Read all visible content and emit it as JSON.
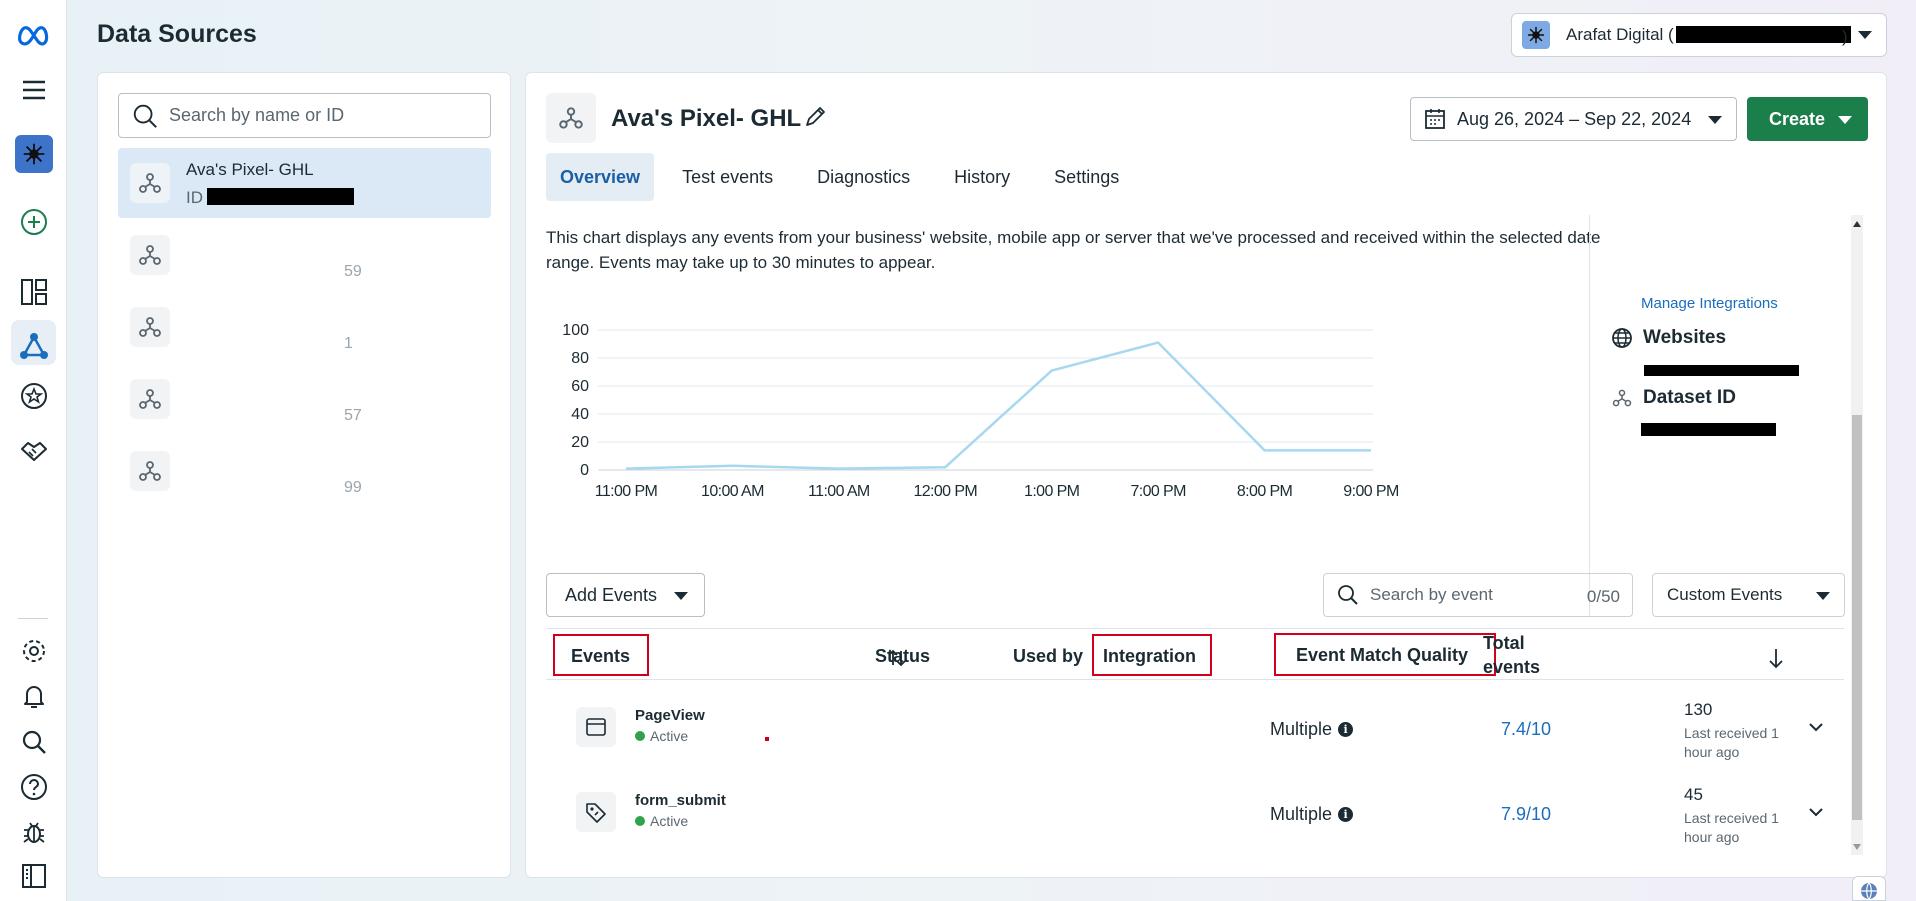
{
  "header": {
    "title": "Data Sources"
  },
  "account": {
    "name": "Arafat Digital (",
    "suffix": ")"
  },
  "sidebar": {
    "search_placeholder": "Search by name or ID",
    "items": [
      {
        "name": "Ava's Pixel- GHL",
        "id_label": "ID"
      },
      {
        "name": "",
        "id_fragment": "59"
      },
      {
        "name": "",
        "id_fragment": "1"
      },
      {
        "name": "",
        "id_fragment": "57"
      },
      {
        "name": "",
        "id_fragment": "99"
      }
    ]
  },
  "pixel": {
    "title": "Ava's Pixel- GHL"
  },
  "toolbar": {
    "date_range": "Aug 26, 2024 – Sep 22, 2024",
    "create_label": "Create"
  },
  "tabs": [
    "Overview",
    "Test events",
    "Diagnostics",
    "History",
    "Settings"
  ],
  "overview": {
    "description": "This chart displays any events from your business' website, mobile app or server that we've processed and received within the selected date range. Events may take up to 30 minutes to appear."
  },
  "chart_data": {
    "type": "line",
    "categories": [
      "11:00 PM",
      "10:00 AM",
      "11:00 AM",
      "12:00 PM",
      "1:00 PM",
      "7:00 PM",
      "8:00 PM",
      "9:00 PM"
    ],
    "series": [
      {
        "values": [
          1,
          3,
          1,
          2,
          71,
          91,
          14,
          14
        ],
        "color": "#a8d8f0"
      }
    ],
    "y_ticks": [
      0,
      20,
      40,
      60,
      80,
      100
    ],
    "ylim": [
      0,
      100
    ],
    "grid": true,
    "title": "",
    "xlabel": "",
    "ylabel": ""
  },
  "side_info": {
    "manage_integrations": "Manage Integrations",
    "websites_label": "Websites",
    "dataset_id_label": "Dataset ID"
  },
  "events_toolbar": {
    "add_events_label": "Add Events",
    "search_placeholder": "Search by event",
    "count": "0/50",
    "filter_label": "Custom Events"
  },
  "table": {
    "headers": {
      "events": "Events",
      "status": "Status",
      "used_by": "Used by",
      "integration": "Integration",
      "emq": "Event Match Quality",
      "total_line1": "Total",
      "total_line2": "events"
    },
    "rows": [
      {
        "name": "PageView",
        "status": "Active",
        "integration": "Multiple",
        "emq": "7.4/10",
        "total": "130",
        "last_received": "Last received 1 hour ago"
      },
      {
        "name": "form_submit",
        "status": "Active",
        "integration": "Multiple",
        "emq": "7.9/10",
        "total": "45",
        "last_received": "Last received 1 hour ago"
      }
    ]
  },
  "colors": {
    "accent": "#1b6dbd",
    "create": "#1a7f4b",
    "highlight": "#d0021b",
    "active": "#31a24c"
  }
}
